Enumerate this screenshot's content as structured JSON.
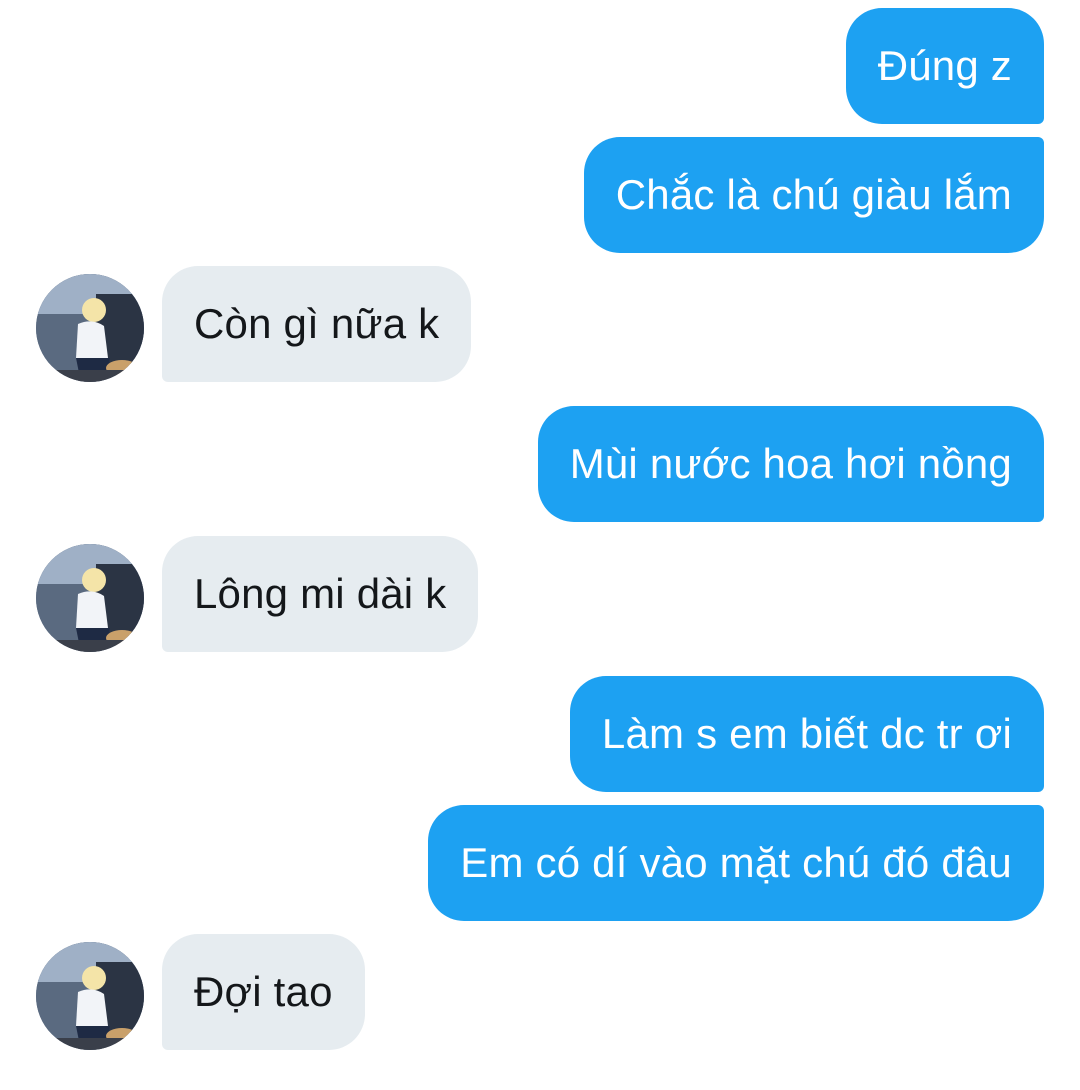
{
  "conversation": {
    "messages": [
      {
        "side": "out",
        "text": "Đúng z"
      },
      {
        "side": "out",
        "text": "Chắc là chú giàu lắm"
      },
      {
        "side": "in",
        "text": "Còn gì nữa k"
      },
      {
        "side": "out",
        "text": "Mùi nước hoa hơi nồng"
      },
      {
        "side": "in",
        "text": "Lông mi dài k"
      },
      {
        "side": "out",
        "text": "Làm s em biết dc tr ơi"
      },
      {
        "side": "out",
        "text": "Em có dí vào mặt chú đó đâu"
      },
      {
        "side": "in",
        "text": "Đợi tao"
      }
    ]
  },
  "colors": {
    "outgoing_bubble": "#1da1f2",
    "incoming_bubble": "#e6ecf0",
    "background": "#ffffff"
  },
  "avatar": {
    "icon": "user-photo-avatar"
  }
}
